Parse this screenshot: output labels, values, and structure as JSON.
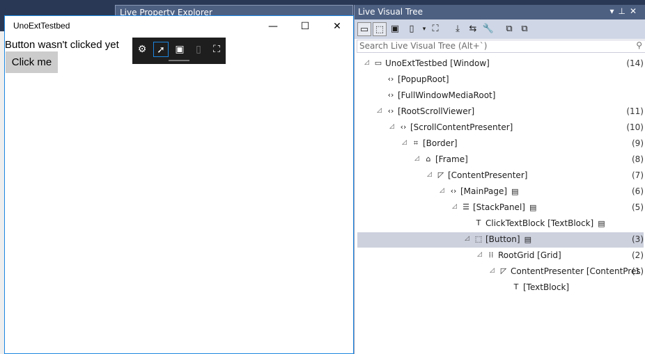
{
  "app_window": {
    "title": "UnoExtTestbed",
    "message": "Button wasn't clicked yet",
    "button": "Click me",
    "minimize": "—",
    "maximize": "☐",
    "close": "✕"
  },
  "property_explorer": {
    "title": "Live Property Explorer"
  },
  "visual_tree": {
    "title": "Live Visual Tree",
    "search_placeholder": "Search Live Visual Tree (Alt+`)",
    "rows": [
      {
        "label": "UnoExtTestbed [Window]",
        "count": "(14)",
        "level": 0,
        "expand": true,
        "icon": "▭"
      },
      {
        "label": "[PopupRoot]",
        "count": "",
        "level": 1,
        "expand": false,
        "icon": "‹›"
      },
      {
        "label": "[FullWindowMediaRoot]",
        "count": "",
        "level": 1,
        "expand": false,
        "icon": "‹›"
      },
      {
        "label": "[RootScrollViewer]",
        "count": "(11)",
        "level": 1,
        "expand": true,
        "icon": "‹›"
      },
      {
        "label": "[ScrollContentPresenter]",
        "count": "(10)",
        "level": 2,
        "expand": true,
        "icon": "‹›"
      },
      {
        "label": "[Border]",
        "count": "(9)",
        "level": 3,
        "expand": true,
        "icon": "⌗"
      },
      {
        "label": "[Frame]",
        "count": "(8)",
        "level": 4,
        "expand": true,
        "icon": "⌂"
      },
      {
        "label": "[ContentPresenter]",
        "count": "(7)",
        "level": 5,
        "expand": true,
        "icon": "◸"
      },
      {
        "label": "[MainPage]",
        "count": "(6)",
        "level": 6,
        "expand": true,
        "icon": "‹›",
        "doc": true
      },
      {
        "label": "[StackPanel]",
        "count": "(5)",
        "level": 7,
        "expand": true,
        "icon": "☰",
        "doc": true
      },
      {
        "label": "ClickTextBlock [TextBlock]",
        "count": "",
        "level": 8,
        "expand": false,
        "icon": "T",
        "doc": true
      },
      {
        "label": "[Button]",
        "count": "(3)",
        "level": 8,
        "expand": true,
        "icon": "⬚",
        "doc": true,
        "selected": true
      },
      {
        "label": "RootGrid [Grid]",
        "count": "(2)",
        "level": 9,
        "expand": true,
        "icon": "⁞⁞"
      },
      {
        "label": "ContentPresenter [ContentPres",
        "count": "(1)",
        "level": 10,
        "expand": true,
        "icon": "◸"
      },
      {
        "label": "[TextBlock]",
        "count": "",
        "level": 11,
        "expand": false,
        "icon": "T"
      }
    ]
  }
}
